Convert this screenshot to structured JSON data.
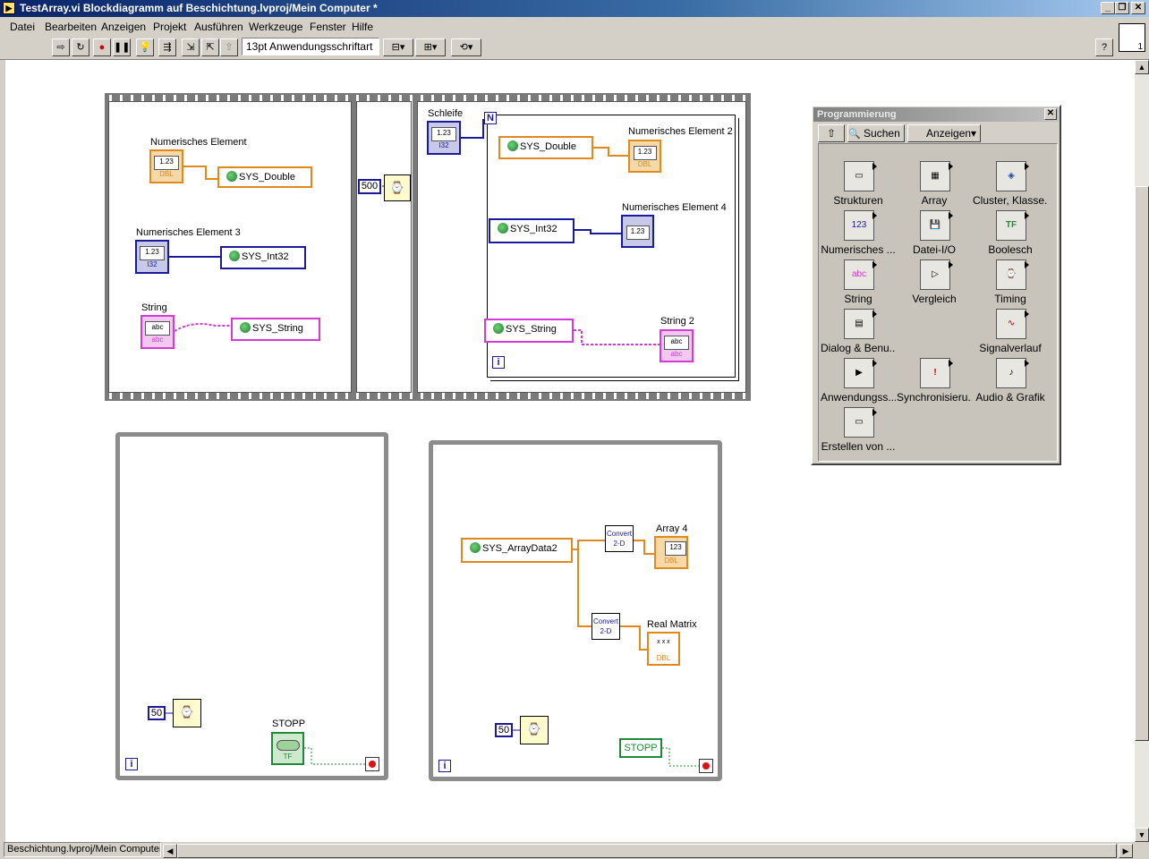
{
  "window": {
    "title": "TestArray.vi Blockdiagramm auf Beschichtung.lvproj/Mein Computer *",
    "icon_glyph": "▶",
    "controls": [
      "_",
      "❐",
      "✕"
    ]
  },
  "menu": [
    "Datei",
    "Bearbeiten",
    "Anzeigen",
    "Projekt",
    "Ausführen",
    "Werkzeuge",
    "Fenster",
    "Hilfe"
  ],
  "toolbar": {
    "font": "13pt Anwendungsschriftart",
    "glyphs": [
      "⇨",
      "↻",
      "●",
      "❚❚",
      "💡",
      "⇶",
      "⇲",
      "⇱",
      "⇧"
    ],
    "align_glyph": "⊟▾",
    "distribute_glyph": "⊞▾",
    "reorder_glyph": "⟲▾",
    "help_glyph": "?",
    "vi_icon_text": "1"
  },
  "status": {
    "project": "Beschichtung.lvproj/Mein Computer"
  },
  "scroll": {
    "up": "▲",
    "down": "▼",
    "left": "◀",
    "right": "▶"
  },
  "diagram": {
    "frame1": {
      "labels": [
        "Numerisches Element",
        "Numerisches Element 3",
        "String"
      ],
      "sv": [
        "SYS_Double",
        "SYS_Int32",
        "SYS_String"
      ],
      "term_text": [
        "1.23",
        "1.23",
        "abc"
      ],
      "term_type": [
        "DBL",
        "I32",
        "abc"
      ]
    },
    "frame2": {
      "wait_ms": "500",
      "wait_glyph": "⌚"
    },
    "frame3": {
      "loop_label": "Schleife",
      "count_glyph": "N",
      "count_text": "1.23",
      "count_type": "I32",
      "sv": [
        "SYS_Double",
        "SYS_Int32",
        "SYS_String"
      ],
      "indicators": [
        "Numerisches Element 2",
        "Numerisches Element 4",
        "String 2"
      ],
      "ind_text": [
        "1.23",
        "1.23",
        "abc"
      ],
      "ind_type": [
        "DBL",
        "",
        "abc"
      ],
      "iter_glyph": "i"
    },
    "loop1": {
      "wait_ms": "50",
      "wait_glyph": "⌚",
      "stop_label": "STOPP",
      "stop_type": "TF",
      "iter_glyph": "i"
    },
    "loop2": {
      "sv": "SYS_ArrayData2",
      "convert_1": [
        "Convert",
        "2-D"
      ],
      "convert_2": [
        "Convert",
        "2-D"
      ],
      "array_label": "Array 4",
      "array_text": "123",
      "array_type": "DBL",
      "matrix_label": "Real Matrix",
      "matrix_text": "x x x",
      "matrix_type": "DBL",
      "wait_ms": "50",
      "wait_glyph": "⌚",
      "stop_label": "STOPP",
      "iter_glyph": "i"
    }
  },
  "palette": {
    "title": "Programmierung",
    "close_glyph": "✕",
    "up_glyph": "⇧",
    "search": "Suchen",
    "search_glyph": "🔍",
    "view": "Anzeigen",
    "view_glyph": "▾",
    "items": [
      {
        "label": "Strukturen",
        "glyph": "▭"
      },
      {
        "label": "Array",
        "glyph": "▦"
      },
      {
        "label": "Cluster, Klasse...",
        "glyph": "◈"
      },
      {
        "label": "Numerisches ...",
        "glyph": "123"
      },
      {
        "label": "Datei-I/O",
        "glyph": "💾"
      },
      {
        "label": "Boolesch",
        "glyph": "TF"
      },
      {
        "label": "String",
        "glyph": "abc"
      },
      {
        "label": "Vergleich",
        "glyph": "▷"
      },
      {
        "label": "Timing",
        "glyph": "⌚"
      },
      {
        "label": "Dialog & Benu...",
        "glyph": "▤"
      },
      {
        "label": "Signalverlauf",
        "glyph": "∿"
      },
      {
        "label": "Anwendungss...",
        "glyph": "▶"
      },
      {
        "label": "Synchronisieru...",
        "glyph": "!"
      },
      {
        "label": "Audio & Grafik",
        "glyph": "♪"
      },
      {
        "label": "Erstellen von ...",
        "glyph": "▭"
      }
    ]
  }
}
